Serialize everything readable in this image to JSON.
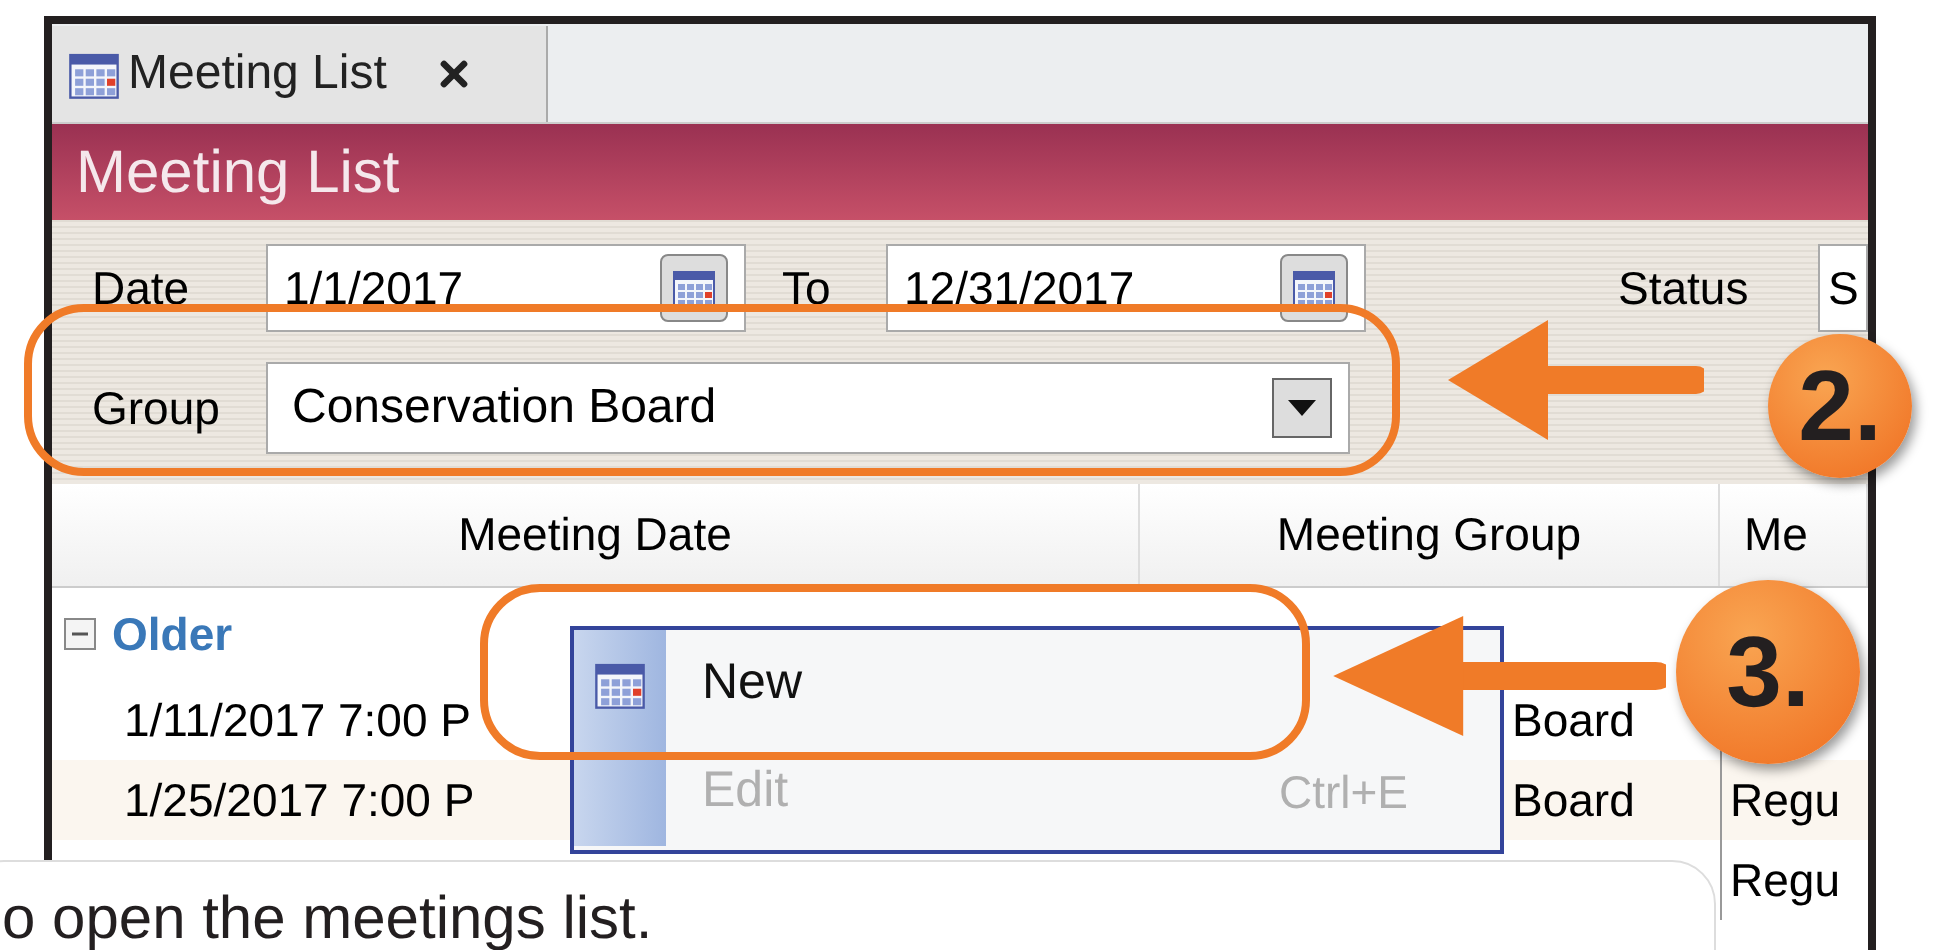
{
  "tab": {
    "label": "Meeting List",
    "selected": true
  },
  "header": {
    "title": "Meeting List"
  },
  "filters": {
    "date_label": "Date",
    "date_from": "1/1/2017",
    "to_label": "To",
    "date_to": "12/31/2017",
    "status_label": "Status",
    "status_value": "S",
    "group_label": "Group",
    "group_value": "Conservation Board"
  },
  "grid": {
    "columns": [
      "Meeting Date",
      "Meeting Group",
      "Me"
    ],
    "group": {
      "label": "Older",
      "expanded": true
    },
    "rows": [
      {
        "date": "1/11/2017 7:00 P",
        "group": "Board"
      },
      {
        "date": "1/25/2017 7:00 P",
        "group": "Board",
        "column_3": "Regu"
      },
      {
        "column_3": "Regu"
      }
    ]
  },
  "context_menu": {
    "items": [
      {
        "label": "New",
        "disabled": false
      },
      {
        "label": "Edit",
        "shortcut": "Ctrl+E",
        "disabled": true
      }
    ]
  },
  "callouts": [
    {
      "number": "2."
    },
    {
      "number": "3."
    }
  ],
  "caption": {
    "text": "o open the meetings list."
  }
}
